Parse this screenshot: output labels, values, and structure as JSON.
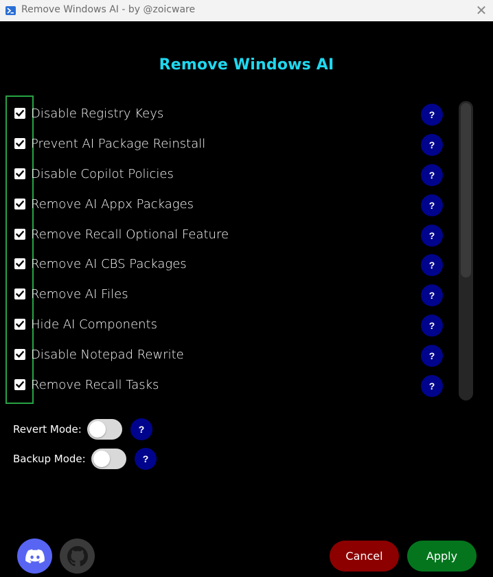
{
  "window": {
    "title": "Remove Windows AI - by @zoicware",
    "close_glyph": "✕"
  },
  "header": {
    "title": "Remove Windows AI"
  },
  "options": [
    {
      "label": "Disable Registry Keys",
      "checked": true,
      "help": "?"
    },
    {
      "label": "Prevent AI Package Reinstall",
      "checked": true,
      "help": "?"
    },
    {
      "label": "Disable Copilot Policies",
      "checked": true,
      "help": "?"
    },
    {
      "label": "Remove AI Appx Packages",
      "checked": true,
      "help": "?"
    },
    {
      "label": "Remove Recall Optional Feature",
      "checked": true,
      "help": "?"
    },
    {
      "label": "Remove AI CBS Packages",
      "checked": true,
      "help": "?"
    },
    {
      "label": "Remove AI Files",
      "checked": true,
      "help": "?"
    },
    {
      "label": "Hide AI Components",
      "checked": true,
      "help": "?"
    },
    {
      "label": "Disable Notepad Rewrite",
      "checked": true,
      "help": "?"
    },
    {
      "label": "Remove Recall Tasks",
      "checked": true,
      "help": "?"
    }
  ],
  "modes": {
    "revert": {
      "label": "Revert Mode:",
      "enabled": false,
      "help": "?"
    },
    "backup": {
      "label": "Backup Mode:",
      "enabled": false,
      "help": "?"
    }
  },
  "footer": {
    "discord_icon": "discord-icon",
    "github_icon": "github-icon",
    "cancel_label": "Cancel",
    "apply_label": "Apply"
  },
  "colors": {
    "title": "#1fd8ef",
    "help_bg": "#00048c",
    "highlight": "#27a444",
    "cancel": "#8c0000",
    "apply": "#04751d",
    "discord": "#5865f2"
  }
}
